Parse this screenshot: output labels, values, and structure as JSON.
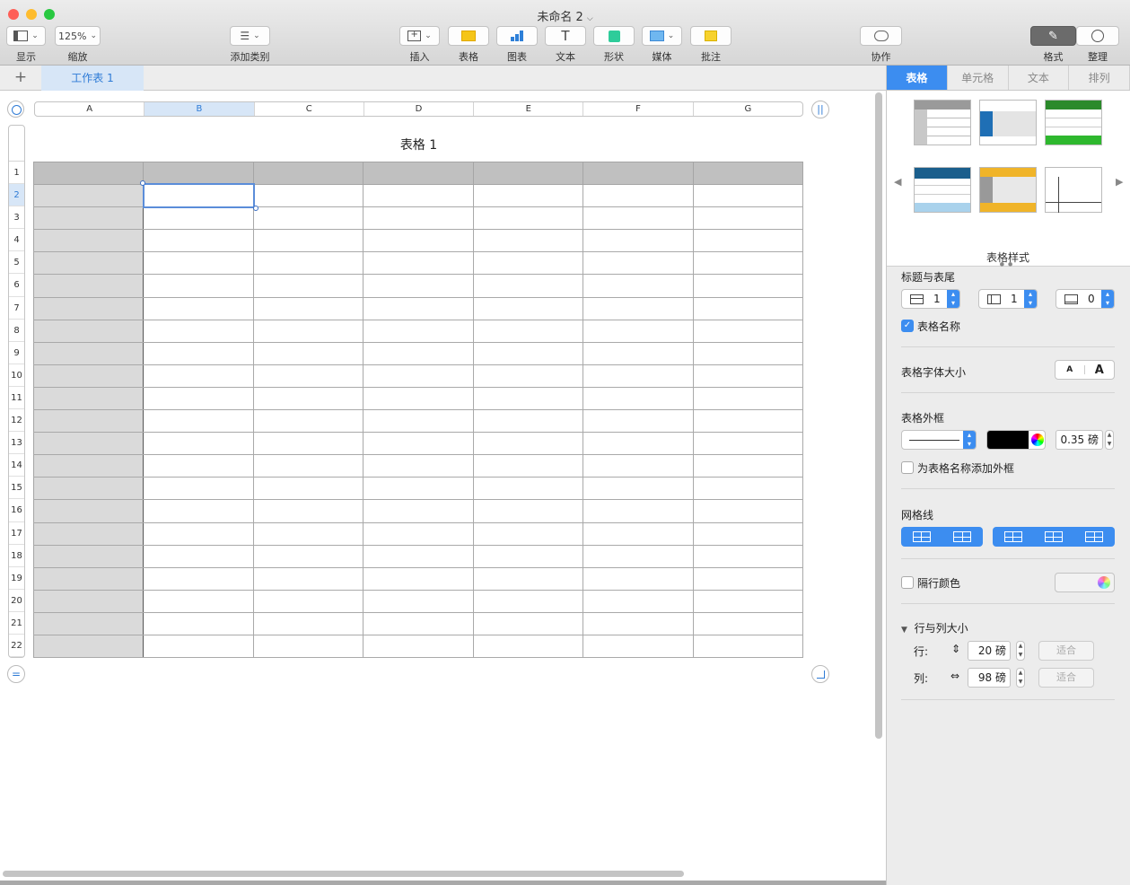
{
  "window": {
    "title": "未命名 2"
  },
  "toolbar": {
    "view": "显示",
    "zoom_value": "125%",
    "zoom": "缩放",
    "add_category": "添加类别",
    "insert": "插入",
    "table": "表格",
    "chart": "图表",
    "text": "文本",
    "shape": "形状",
    "media": "媒体",
    "comment": "批注",
    "collaborate": "协作",
    "format": "格式",
    "organize": "整理"
  },
  "sheets": {
    "tab1": "工作表 1"
  },
  "table": {
    "title": "表格 1",
    "columns": [
      "A",
      "B",
      "C",
      "D",
      "E",
      "F",
      "G"
    ],
    "rows": [
      "1",
      "2",
      "3",
      "4",
      "5",
      "6",
      "7",
      "8",
      "9",
      "10",
      "11",
      "12",
      "13",
      "14",
      "15",
      "16",
      "17",
      "18",
      "19",
      "20",
      "21",
      "22"
    ],
    "selected_column": "B",
    "selected_row": "2"
  },
  "panel": {
    "tabs": [
      "表格",
      "单元格",
      "文本",
      "排列"
    ],
    "styles_caption": "表格样式",
    "headers_footers": {
      "label": "标题与表尾",
      "header_rows": "1",
      "header_cols": "1",
      "footer_rows": "0"
    },
    "table_name_checkbox": "表格名称",
    "font_size_label": "表格字体大小",
    "font_small": "A",
    "font_large": "A",
    "outline_label": "表格外框",
    "outline_width": "0.35 磅",
    "outline_name_checkbox": "为表格名称添加外框",
    "gridlines_label": "网格线",
    "alternating_rows": "隔行颜色",
    "row_col_size": "行与列大小",
    "row_label": "行:",
    "row_value": "20 磅",
    "col_label": "列:",
    "col_value": "98 磅",
    "fit": "适合"
  },
  "colors": {
    "accent": "#3c8df0",
    "header_row": "#c0c0c0",
    "header_col": "#dadada"
  }
}
